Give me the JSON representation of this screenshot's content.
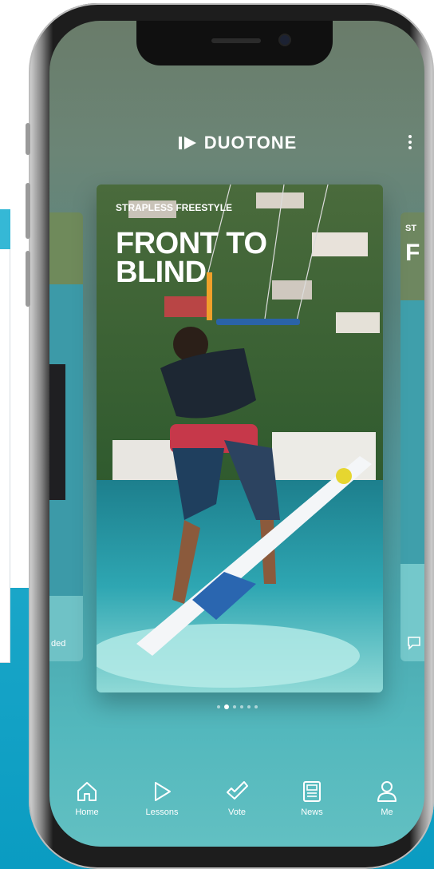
{
  "app": {
    "brand": "DUOTONE"
  },
  "main_card": {
    "kicker": "STRAPLESS FREESTYLE",
    "title": "FRONT TO BLIND"
  },
  "left_card": {
    "caption": "ded"
  },
  "right_card": {
    "kicker": "ST",
    "title": "F"
  },
  "carousel": {
    "page_count": 6,
    "active_index": 1
  },
  "tabbar": {
    "items": [
      {
        "label": "Home",
        "icon": "home-icon"
      },
      {
        "label": "Lessons",
        "icon": "play-icon"
      },
      {
        "label": "Vote",
        "icon": "check-icon"
      },
      {
        "label": "News",
        "icon": "news-icon"
      },
      {
        "label": "Me",
        "icon": "user-icon"
      }
    ]
  },
  "colors": {
    "accent_teal": "#0a9cc2",
    "screen_bottom": "#62c0c2",
    "text": "#ffffff"
  }
}
